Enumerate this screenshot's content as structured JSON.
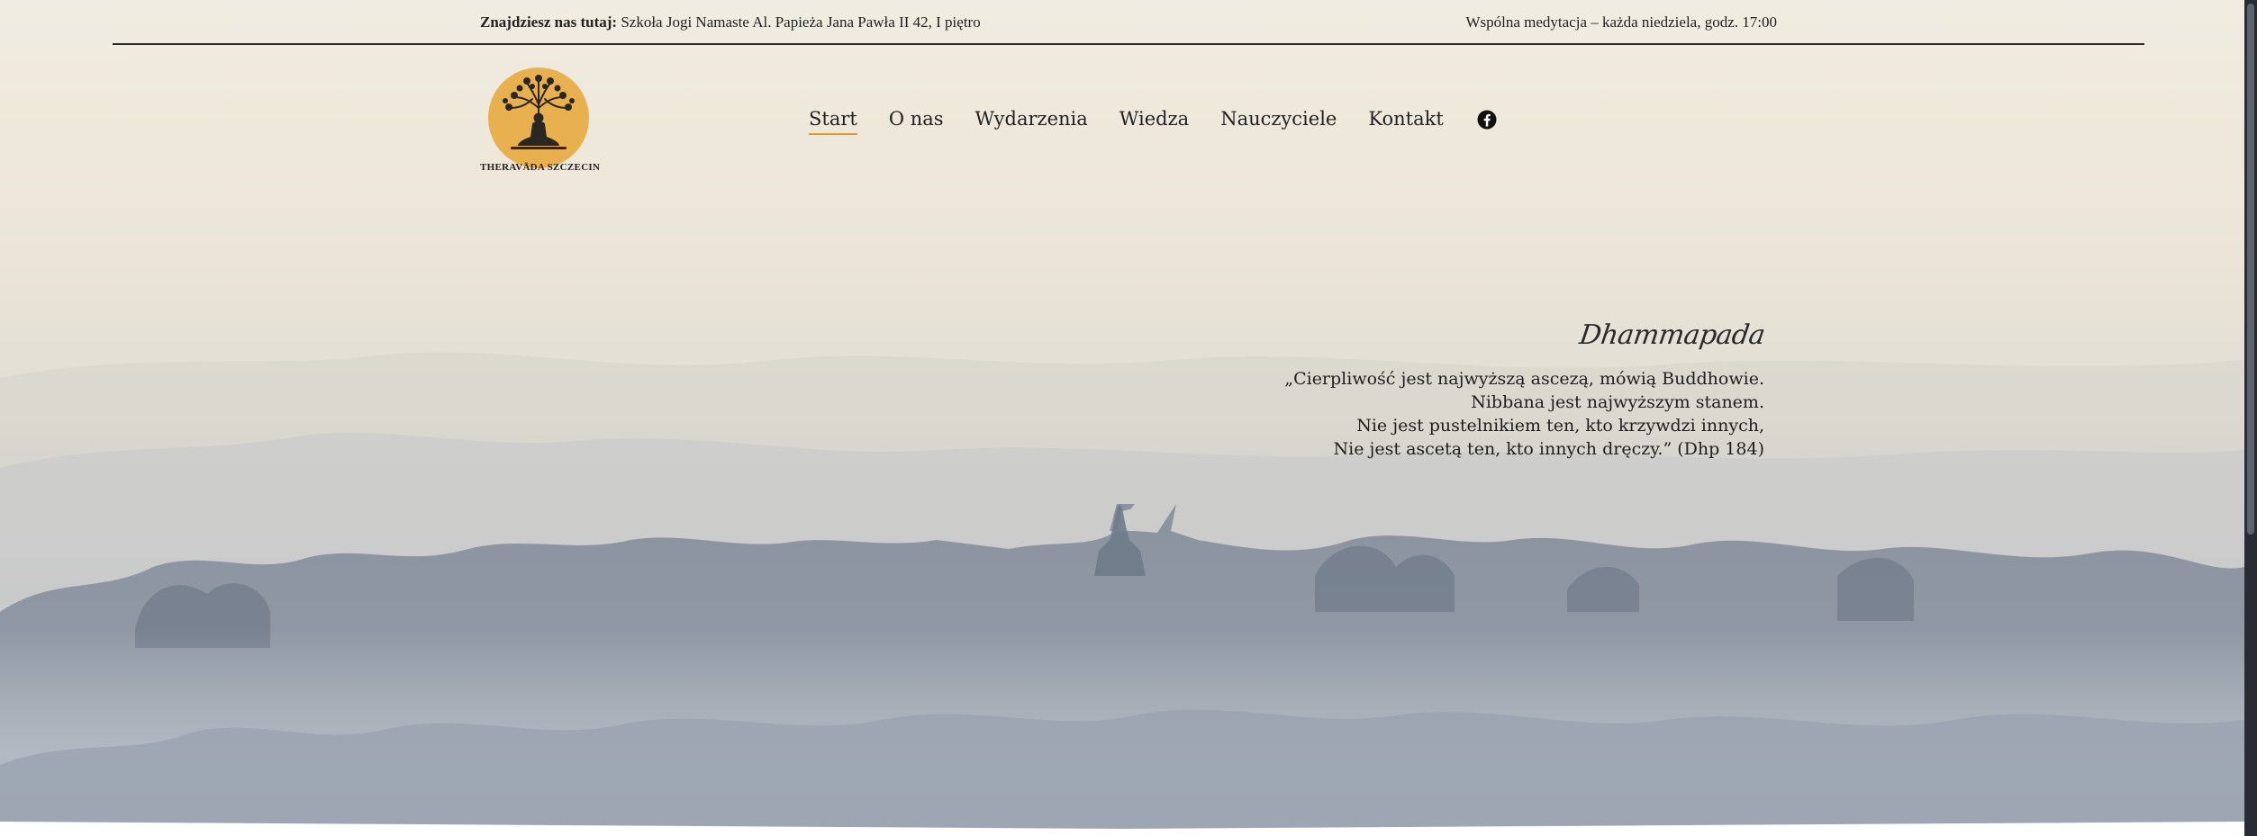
{
  "topbar": {
    "location_label": "Znajdziesz nas tutaj:",
    "location_value": "Szkoła Jogi Namaste Al. Papieża Jana Pawła II 42, I piętro",
    "meditation_note": "Wspólna medytacja – każda niedziela, godz. 17:00"
  },
  "logo": {
    "icon": "buddha-tree-logo",
    "caption": "THERAVĀDA SZCZECIN"
  },
  "nav": {
    "items": [
      {
        "label": "Start",
        "active": true
      },
      {
        "label": "O nas",
        "active": false
      },
      {
        "label": "Wydarzenia",
        "active": false
      },
      {
        "label": "Wiedza",
        "active": false
      },
      {
        "label": "Nauczyciele",
        "active": false
      },
      {
        "label": "Kontakt",
        "active": false
      }
    ],
    "social_icon": "facebook-icon"
  },
  "quote": {
    "title": "Dhammapada",
    "lines": [
      "„Cierpliwość jest najwyższą ascezą, mówią Buddhowie.",
      "Nibbana jest najwyższym stanem.",
      "Nie jest pustelnikiem ten, kto krzywdzi innych,",
      "Nie jest ascetą ten, kto innych dręczy.” (Dhp 184)"
    ]
  },
  "colors": {
    "accent": "#e29a2f",
    "logo_circle": "#e9b04f",
    "text": "#1f1f1f",
    "sky_top": "#efe9dc",
    "mist": "#c9cbcf",
    "forest": "#7d8898"
  }
}
